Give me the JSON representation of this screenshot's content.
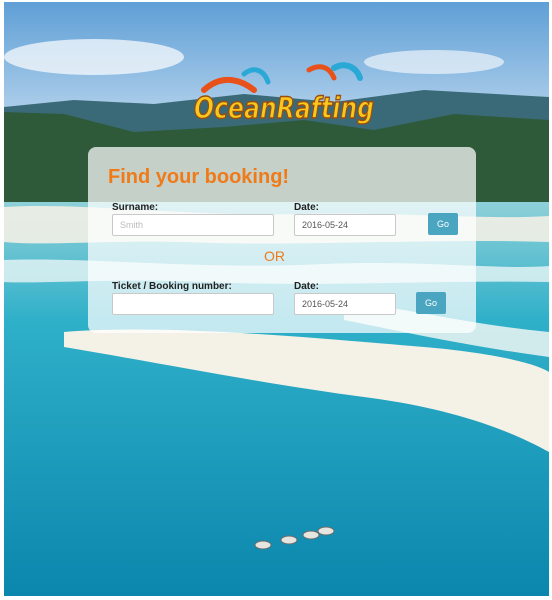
{
  "brand": {
    "logo_text": "OceanRafting"
  },
  "form": {
    "title": "Find your booking!",
    "surname_label": "Surname:",
    "surname_placeholder": "Smith",
    "date_label": "Date:",
    "date1_value": "2016-05-24",
    "go_label": "Go",
    "or_text": "OR",
    "ticket_label": "Ticket / Booking number:",
    "ticket_value": "",
    "date2_value": "2016-05-24"
  },
  "colors": {
    "accent": "#f07a17",
    "button": "#4aa5c1"
  }
}
